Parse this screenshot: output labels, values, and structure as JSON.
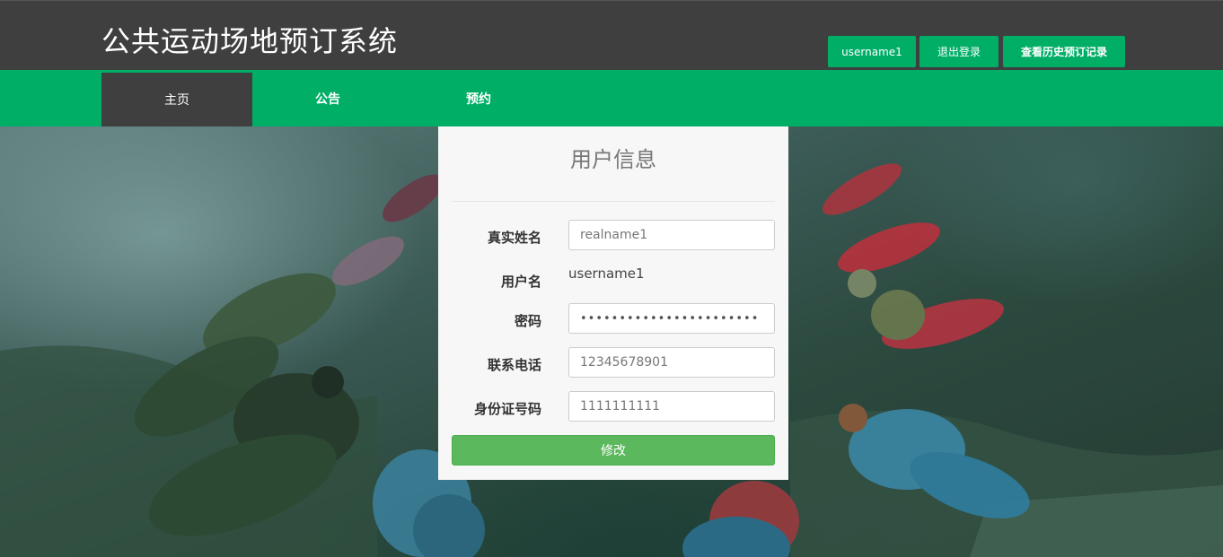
{
  "header": {
    "title": "公共运动场地预订系统",
    "username_button": "username1",
    "logout_button": "退出登录",
    "history_button": "查看历史预订记录"
  },
  "nav": {
    "items": [
      {
        "label": "主页",
        "active": true
      },
      {
        "label": "公告",
        "active": false
      },
      {
        "label": "预约",
        "active": false
      }
    ]
  },
  "form": {
    "title": "用户信息",
    "realname_label": "真实姓名",
    "realname_value": "realname1",
    "username_label": "用户名",
    "username_value": "username1",
    "password_label": "密码",
    "password_value": "•••••••••••••••••••••••",
    "phone_label": "联系电话",
    "phone_value": "12345678901",
    "idcard_label": "身份证号码",
    "idcard_value": "1111111111",
    "submit_label": "修改"
  },
  "colors": {
    "header_bg": "#3f3f3f",
    "accent_green": "#00ae66",
    "submit_green": "#5cb85c"
  }
}
